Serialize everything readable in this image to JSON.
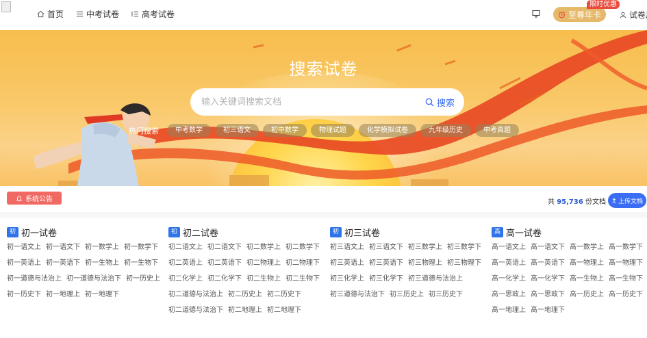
{
  "nav": {
    "items": [
      {
        "label": "首页",
        "icon": "home-icon"
      },
      {
        "label": "中考试卷",
        "icon": "list-icon"
      },
      {
        "label": "高考试卷",
        "icon": "list-icon"
      }
    ],
    "vip_label": "至尊年卡",
    "vip_badge": "限时优惠",
    "user_label": "试卷用户"
  },
  "banner": {
    "title": "搜索试卷",
    "search_placeholder": "输入关键词搜索文档",
    "search_button": "搜索",
    "hot_label": "热门搜索",
    "tags": [
      "中考数学",
      "初三语文",
      "初中数学",
      "物理试题",
      "化学模拟试卷",
      "九年级历史",
      "中考真题"
    ]
  },
  "notice": {
    "label": "系统公告",
    "count_prefix": "共",
    "count": "95,736",
    "count_suffix": "份文档",
    "upload_label": "上传文档"
  },
  "columns": [
    {
      "badge": "初一",
      "title": "初一试卷",
      "links": [
        "初一语文上",
        "初一语文下",
        "初一数学上",
        "初一数学下",
        "初一英语上",
        "初一英语下",
        "初一生物上",
        "初一生物下",
        "初一道德与法治上",
        "初一道德与法治下",
        "初一历史上",
        "初一历史下",
        "初一地理上",
        "初一地理下"
      ]
    },
    {
      "badge": "初二",
      "title": "初二试卷",
      "links": [
        "初二语文上",
        "初二语文下",
        "初二数学上",
        "初二数学下",
        "初二英语上",
        "初二英语下",
        "初二物理上",
        "初二物理下",
        "初二化学上",
        "初二化学下",
        "初二生物上",
        "初二生物下",
        "初二道德与法治上",
        "初二历史上",
        "初二历史下",
        "初二道德与法治下",
        "初二地理上",
        "初二地理下"
      ]
    },
    {
      "badge": "初三",
      "title": "初三试卷",
      "links": [
        "初三语文上",
        "初三语文下",
        "初三数学上",
        "初三数学下",
        "初三英语上",
        "初三英语下",
        "初三物理上",
        "初三物理下",
        "初三化学上",
        "初三化学下",
        "初三道德与法治上",
        "初三道德与法治下",
        "初三历史上",
        "初三历史下"
      ]
    },
    {
      "badge": "高一",
      "title": "高一试卷",
      "links": [
        "高一语文上",
        "高一语文下",
        "高一数学上",
        "高一数学下",
        "高一英语上",
        "高一英语下",
        "高一物理上",
        "高一物理下",
        "高一化学上",
        "高一化学下",
        "高一生物上",
        "高一生物下",
        "高一思政上",
        "高一思政下",
        "高一历史上",
        "高一历史下",
        "高一地理上",
        "高一地理下"
      ]
    }
  ],
  "colors": {
    "accent": "#3a6cf4",
    "vip": "#e5b86a",
    "notice": "#f06a63",
    "badge": "#2f74e8"
  }
}
